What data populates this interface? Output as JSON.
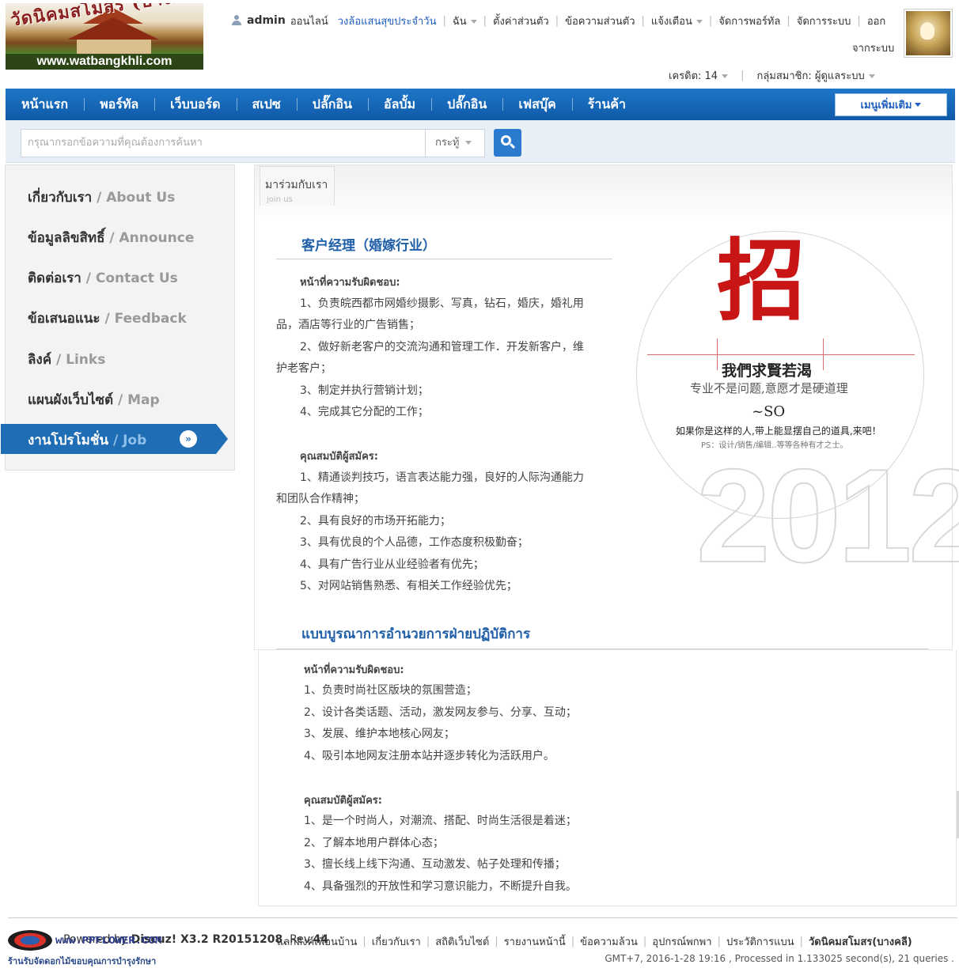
{
  "logo": {
    "thai_text": "วัดนิคมสโมสร (บางคลี)",
    "url_text": "www.watbangkhli.com"
  },
  "topbar": {
    "username": "admin",
    "status": "ออนไลน์",
    "wheel_link": "วงล้อแสนสุขประจำวัน",
    "menu_me": "ฉัน",
    "settings": "ตั้งค่าส่วนตัว",
    "messages": "ข้อความส่วนตัว",
    "notifications": "แจ้งเตือน",
    "portal_admin": "จัดการพอร์ทัล",
    "system_admin": "จัดการระบบ",
    "logout_line1": "ออก",
    "logout_line2": "จากระบบ",
    "credits": "เครดิต: 14",
    "group": "กลุ่มสมาชิก: ผู้ดูแลระบบ"
  },
  "nav": {
    "items": [
      "หน้าแรก",
      "พอร์ทัล",
      "เว็บบอร์ด",
      "สเปซ",
      "ปลั๊กอิน",
      "อัลบั้ม",
      "ปลั๊กอิน",
      "เฟสบุ๊ค",
      "ร้านค้า"
    ],
    "more_label": "เมนูเพิ่มเติม"
  },
  "search": {
    "placeholder": "กรุณากรอกข้อความที่คุณต้องการค้นหา",
    "type_selected": "กระทู้"
  },
  "sidebar": {
    "items": [
      {
        "th": "เกี่ยวกับเรา",
        "en": " / About Us"
      },
      {
        "th": "ข้อมูลลิขสิทธิ์",
        "en": " / Announce"
      },
      {
        "th": "ติดต่อเรา",
        "en": " / Contact Us"
      },
      {
        "th": "ข้อเสนอแนะ",
        "en": " / Feedback"
      },
      {
        "th": "ลิงค์",
        "en": " / Links"
      },
      {
        "th": "แผนผังเว็บไซต์",
        "en": " / Map"
      },
      {
        "th": "งานโปรโมชั่น",
        "en": " / Job"
      }
    ]
  },
  "content": {
    "tab_title": "มาร่วมกับเรา",
    "tab_subtitle": "join us",
    "job1": {
      "title": "客户经理（婚嫁行业）",
      "duties_label": "หน้าที่ความรับผิดชอบ:",
      "duties": [
        "1、负责皖西都市网婚纱摄影、写真，钻石，婚庆，婚礼用",
        "品，酒店等行业的广告销售；",
        "2、做好新老客户的交流沟通和管理工作．开发新客户，维",
        "护老客户；",
        "3、制定并执行营销计划；",
        "4、完成其它分配的工作；"
      ],
      "req_label": "คุณสมบัติผู้สมัคร:",
      "reqs": [
        "1、精通谈判技巧，语言表达能力强，良好的人际沟通能力",
        "和团队合作精神；",
        "2、具有良好的市场开拓能力；",
        "3、具有优良的个人品德，工作态度积极勤奋；",
        "4、具有广告行业从业经验者有优先；",
        "5、对网站销售熟悉、有相关工作经验优先；"
      ]
    },
    "job2": {
      "title": "แบบบูรณาการอำนวยการฝ่ายปฏิบัติการ",
      "duties_label": "หน้าที่ความรับผิดชอบ:",
      "duties": [
        "1、负责时尚社区版块的氛围营造；",
        "2、设计各类话题、活动，激发网友参与、分享、互动；",
        "3、发展、维护本地核心网友；",
        "4、吸引本地网友注册本站并逐步转化为活跃用户。"
      ],
      "req_label": "คุณสมบัติผู้สมัคร:",
      "reqs": [
        "1、是一个时尚人，对潮流、搭配、时尚生活很是着迷；",
        "2、了解本地用户群体心态；",
        "3、擅长线上线下沟通、互动激发、帖子处理和传播；",
        "4、具备强烈的开放性和学习意识能力，不断提升自我。"
      ]
    },
    "graphic": {
      "big_char": "招",
      "line1": "我們求賢若渴",
      "line2": "专业不是问题,意愿才是硬道理",
      "line3": "~SO",
      "line4": "如果你是这样的人,带上能显摆自己的道具,来吧！",
      "line5": "PS：设计/销售/编辑..等等各种有才之士。",
      "year": "2012"
    }
  },
  "footer": {
    "logo_text": "www.PPFLOWER.COM",
    "logo_sub": "ร้านรับจัดดอกไม้ขอบคุณการบำรุงรักษา",
    "version_prefix": "Powered by ",
    "version_brand": "Discuz!",
    "version_num": " X3.2 R20151208",
    "version_rev": ", Rev.",
    "version_rev_num": "44",
    "links": [
      "แลกลิงค์เพื่อนบ้าน",
      "เกี่ยวกับเรา",
      "สถิติเว็บไซต์",
      "รายงานหน้านี้",
      "ข้อความล้วน",
      "อุปกรณ์พกพา",
      "ประวัติการแบน"
    ],
    "site_name": "วัดนิคมสโมสร(บางคลี)",
    "stats": "GMT+7, 2016-1-28 19:16 , Processed in 1.133025 second(s), 21 queries ."
  }
}
